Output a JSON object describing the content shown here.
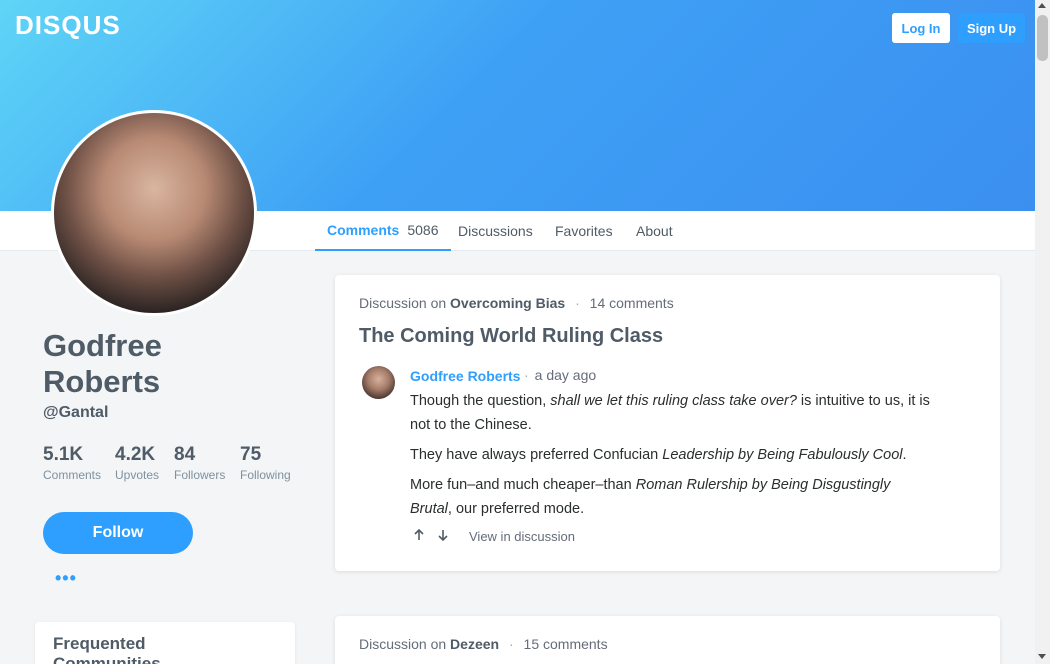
{
  "header": {
    "logo": "DISQUS",
    "login_label": "Log In",
    "signup_label": "Sign Up"
  },
  "tabs": [
    {
      "label": "Comments",
      "count": "5086"
    },
    {
      "label": "Discussions"
    },
    {
      "label": "Favorites"
    },
    {
      "label": "About"
    }
  ],
  "profile": {
    "name": "Godfree Roberts",
    "handle": "@Gantal",
    "stats": [
      {
        "value": "5.1K",
        "label": "Comments"
      },
      {
        "value": "4.2K",
        "label": "Upvotes"
      },
      {
        "value": "84",
        "label": "Followers"
      },
      {
        "value": "75",
        "label": "Following"
      }
    ],
    "follow_label": "Follow",
    "more_label": "•••"
  },
  "sidebar": {
    "communities_title": "Frequented Communities"
  },
  "feed": [
    {
      "prefix": "Discussion on",
      "community": "Overcoming Bias",
      "comments": "14 comments",
      "title": "The Coming World Ruling Class",
      "author": "Godfree Roberts",
      "time": "a day ago",
      "p1_a": "Though the question, ",
      "p1_em": "shall we let this ruling class take over?",
      "p1_b": " is intuitive to us, it is not to the Chinese.",
      "p2_a": "They have always preferred Confucian ",
      "p2_em": "Leadership by Being Fabulously Cool",
      "p2_b": ".",
      "p3_a": "More fun–and much cheaper–than ",
      "p3_em": "Roman Rulership by Being Disgustingly Brutal",
      "p3_b": ", our preferred mode.",
      "view_label": "View in discussion"
    },
    {
      "prefix": "Discussion on",
      "community": "Dezeen",
      "comments": "15 comments"
    }
  ],
  "colors": {
    "accent": "#2e9fff",
    "hero_start": "#5fd5f6",
    "hero_end": "#3b8ff0"
  }
}
